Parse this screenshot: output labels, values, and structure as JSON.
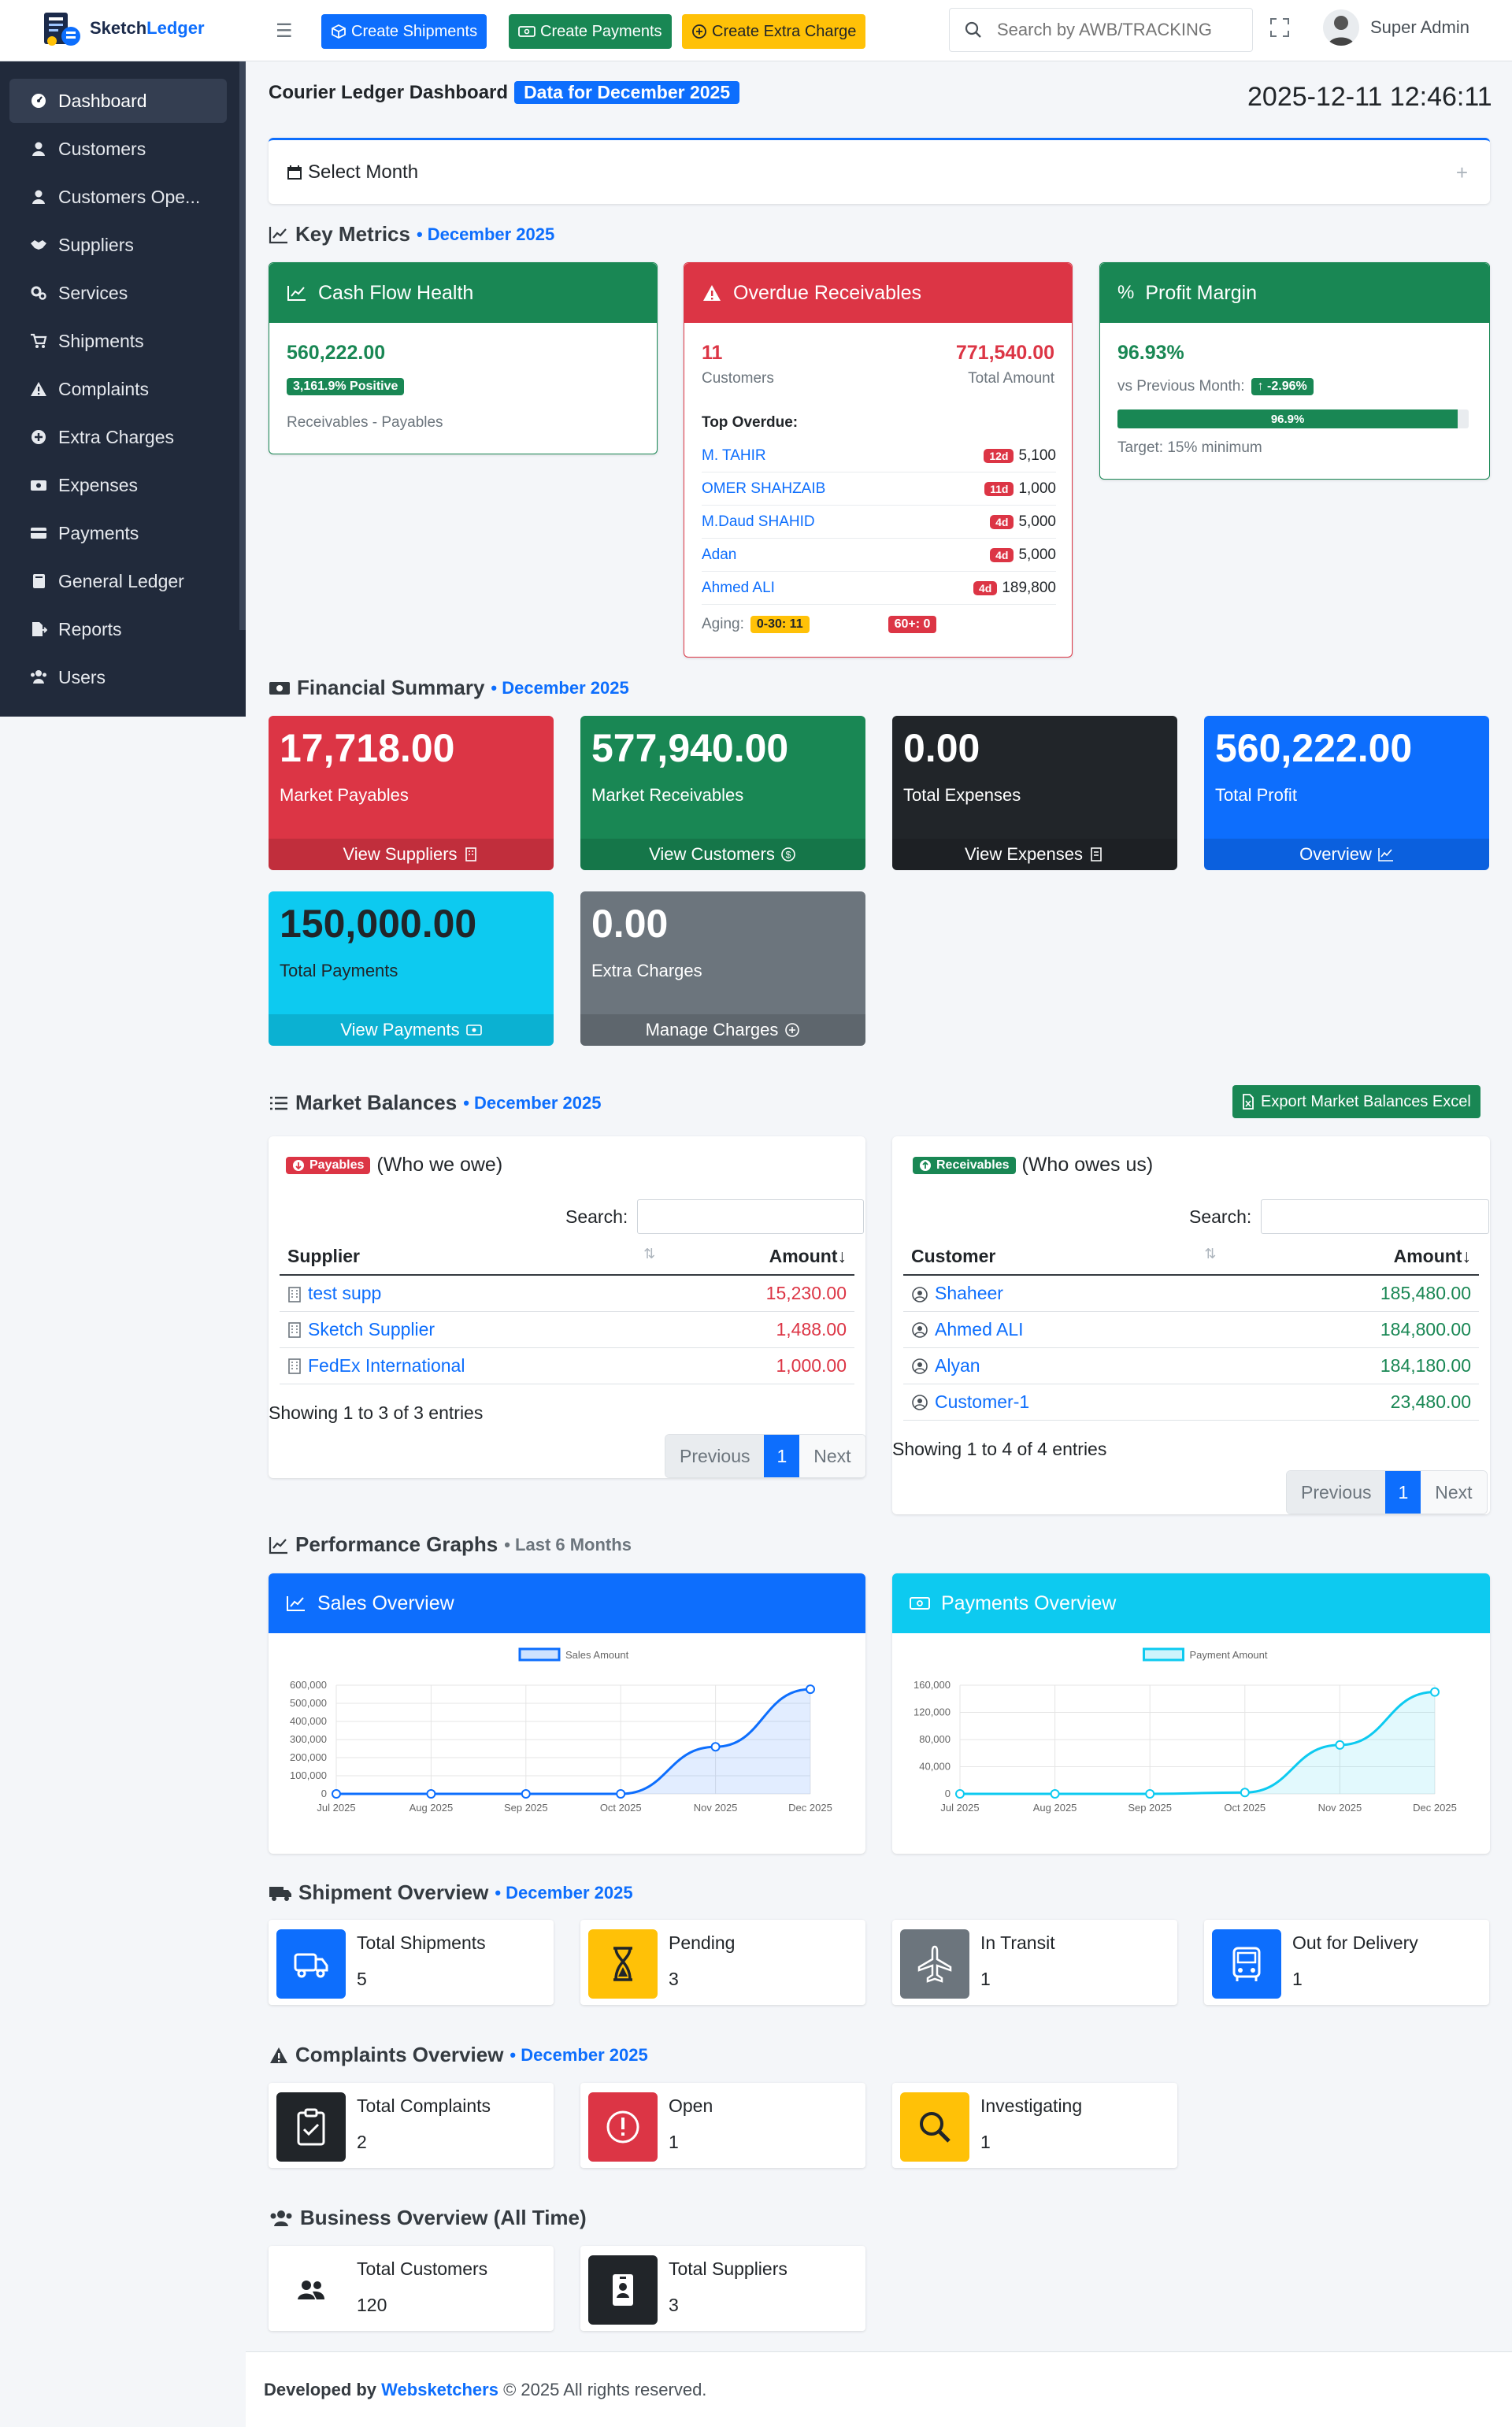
{
  "brand": {
    "part1": "Sketch",
    "part2": "Ledger"
  },
  "toolbar": {
    "create_shipments": "Create Shipments",
    "create_payments": "Create Payments",
    "create_extra_charge": "Create Extra Charge"
  },
  "search": {
    "placeholder": "Search by AWB/TRACKING"
  },
  "user": {
    "name": "Super Admin"
  },
  "sidebar": {
    "items": [
      {
        "label": "Dashboard",
        "icon": "dashboard-icon"
      },
      {
        "label": "Customers",
        "icon": "user-icon"
      },
      {
        "label": "Customers Ope...",
        "icon": "user-icon"
      },
      {
        "label": "Suppliers",
        "icon": "handshake-icon"
      },
      {
        "label": "Services",
        "icon": "cogs-icon"
      },
      {
        "label": "Shipments",
        "icon": "cart-icon"
      },
      {
        "label": "Complaints",
        "icon": "warning-icon"
      },
      {
        "label": "Extra Charges",
        "icon": "plus-circle-icon"
      },
      {
        "label": "Expenses",
        "icon": "money-icon"
      },
      {
        "label": "Payments",
        "icon": "credit-card-icon"
      },
      {
        "label": "General Ledger",
        "icon": "book-icon"
      },
      {
        "label": "Reports",
        "icon": "file-export-icon"
      },
      {
        "label": "Users",
        "icon": "users-icon"
      }
    ]
  },
  "page": {
    "title": "Courier Ledger Dashboard",
    "badge": "Data for December 2025",
    "datetime": "2025-12-11 12:46:11",
    "select_month": "Select Month",
    "select_plus": "+"
  },
  "sections": {
    "key_metrics": {
      "title": "Key Metrics",
      "sub": "• December 2025"
    },
    "financial": {
      "title": "Financial Summary",
      "sub": "• December 2025"
    },
    "market": {
      "title": "Market Balances",
      "sub": "• December 2025",
      "export": "Export Market Balances Excel"
    },
    "performance": {
      "title": "Performance Graphs",
      "sub": "• Last 6 Months"
    },
    "shipment": {
      "title": "Shipment Overview",
      "sub": "• December 2025"
    },
    "complaints": {
      "title": "Complaints Overview",
      "sub": "• December 2025"
    },
    "business": {
      "title": "Business Overview (All Time)"
    }
  },
  "cashflow": {
    "title": "Cash Flow Health",
    "value": "560,222.00",
    "badge": "3,161.9% Positive",
    "note": "Receivables - Payables",
    "color": "#198754"
  },
  "overdue": {
    "title": "Overdue Receivables",
    "count": "11",
    "count_label": "Customers",
    "amount": "771,540.00",
    "amount_label": "Total Amount",
    "top_label": "Top Overdue:",
    "rows": [
      {
        "name": "M. TAHIR",
        "days": "12d",
        "amount": "5,100"
      },
      {
        "name": "OMER SHAHZAIB",
        "days": "11d",
        "amount": "1,000"
      },
      {
        "name": "M.Daud SHAHID",
        "days": "4d",
        "amount": "5,000"
      },
      {
        "name": "Adan",
        "days": "4d",
        "amount": "5,000"
      },
      {
        "name": "Ahmed ALI",
        "days": "4d",
        "amount": "189,800"
      }
    ],
    "aging_label": "Aging:",
    "aging_a": "0-30: 11",
    "aging_b": "60+: 0",
    "color": "#dc3545"
  },
  "profit": {
    "title": "Profit Margin",
    "value": "96.93%",
    "vs_label": "vs Previous Month:",
    "vs_badge": "↑ -2.96%",
    "bar_label": "96.9%",
    "bar_fraction": 0.969,
    "target": "Target: 15% minimum"
  },
  "financial_cards": [
    {
      "value": "17,718.00",
      "label": "Market Payables",
      "link": "View Suppliers",
      "color": "#dc3545",
      "icon": "building-icon"
    },
    {
      "value": "577,940.00",
      "label": "Market Receivables",
      "link": "View Customers",
      "color": "#198754",
      "icon": "dollar-circle-icon"
    },
    {
      "value": "0.00",
      "label": "Total Expenses",
      "link": "View Expenses",
      "color": "#212529",
      "icon": "receipt-icon"
    },
    {
      "value": "560,222.00",
      "label": "Total Profit",
      "link": "Overview",
      "color": "#0d6efd",
      "icon": "chart-line-icon"
    },
    {
      "value": "150,000.00",
      "label": "Total Payments",
      "link": "View Payments",
      "color": "#0dcaf0",
      "icon": "cash-icon"
    },
    {
      "value": "0.00",
      "label": "Extra Charges",
      "link": "Manage Charges",
      "color": "#6c757d",
      "icon": "plus-circle-icon"
    }
  ],
  "payables": {
    "badge": "Payables",
    "subtitle": "(Who we owe)",
    "search_label": "Search:",
    "col1": "Supplier",
    "col2": "Amount",
    "rows": [
      {
        "name": "test supp",
        "amount": "15,230.00"
      },
      {
        "name": "Sketch Supplier",
        "amount": "1,488.00"
      },
      {
        "name": "FedEx International",
        "amount": "1,000.00"
      }
    ],
    "info": "Showing 1 to 3 of 3 entries",
    "prev": "Previous",
    "page": "1",
    "next": "Next"
  },
  "receivables": {
    "badge": "Receivables",
    "subtitle": "(Who owes us)",
    "search_label": "Search:",
    "col1": "Customer",
    "col2": "Amount",
    "rows": [
      {
        "name": "Shaheer",
        "amount": "185,480.00"
      },
      {
        "name": "Ahmed ALI",
        "amount": "184,800.00"
      },
      {
        "name": "Alyan",
        "amount": "184,180.00"
      },
      {
        "name": "Customer-1",
        "amount": "23,480.00"
      }
    ],
    "info": "Showing 1 to 4 of 4 entries",
    "prev": "Previous",
    "page": "1",
    "next": "Next"
  },
  "charts_header": {
    "sales": "Sales Overview",
    "payments": "Payments Overview"
  },
  "chart_data": [
    {
      "type": "area",
      "title": "",
      "x": [
        "Jul 2025",
        "Aug 2025",
        "Sep 2025",
        "Oct 2025",
        "Nov 2025",
        "Dec 2025"
      ],
      "series": [
        {
          "name": "Sales Amount",
          "values": [
            0,
            0,
            0,
            0,
            260000,
            577940
          ]
        }
      ],
      "ylim": [
        0,
        600000
      ],
      "yticks": [
        "0",
        "100,000",
        "200,000",
        "300,000",
        "400,000",
        "500,000",
        "600,000"
      ],
      "ytick_values": [
        0,
        100000,
        200000,
        300000,
        400000,
        500000,
        600000
      ],
      "grid": true,
      "legend": "top-center",
      "color": "#0d6efd"
    },
    {
      "type": "area",
      "title": "",
      "x": [
        "Jul 2025",
        "Aug 2025",
        "Sep 2025",
        "Oct 2025",
        "Nov 2025",
        "Dec 2025"
      ],
      "series": [
        {
          "name": "Payment Amount",
          "values": [
            0,
            0,
            0,
            2000,
            72000,
            150000
          ]
        }
      ],
      "ylim": [
        0,
        160000
      ],
      "yticks": [
        "0",
        "40,000",
        "80,000",
        "120,000",
        "160,000"
      ],
      "ytick_values": [
        0,
        40000,
        80000,
        120000,
        160000
      ],
      "grid": true,
      "legend": "top-center",
      "color": "#0dcaf0"
    }
  ],
  "shipment_boxes": [
    {
      "label": "Total Shipments",
      "value": "5",
      "color": "#0d6efd",
      "icon": "truck-icon"
    },
    {
      "label": "Pending",
      "value": "3",
      "color": "#ffc107",
      "icon": "hourglass-icon"
    },
    {
      "label": "In Transit",
      "value": "1",
      "color": "#6c757d",
      "icon": "plane-icon"
    },
    {
      "label": "Out for Delivery",
      "value": "1",
      "color": "#0d6efd",
      "icon": "bus-icon"
    }
  ],
  "complaint_boxes": [
    {
      "label": "Total Complaints",
      "value": "2",
      "color": "#212529",
      "icon": "clipboard-check-icon"
    },
    {
      "label": "Open",
      "value": "1",
      "color": "#dc3545",
      "icon": "exclamation-circle-icon"
    },
    {
      "label": "Investigating",
      "value": "1",
      "color": "#ffc107",
      "icon": "magnifier-icon"
    }
  ],
  "business_boxes": [
    {
      "label": "Total Customers",
      "value": "120",
      "color": "#ffffff",
      "icon": "users-icon"
    },
    {
      "label": "Total Suppliers",
      "value": "3",
      "color": "#212529",
      "icon": "id-badge-icon"
    }
  ],
  "footer": {
    "prefix": "Developed by",
    "company": "Websketchers",
    "suffix": "© 2025 All rights reserved."
  }
}
